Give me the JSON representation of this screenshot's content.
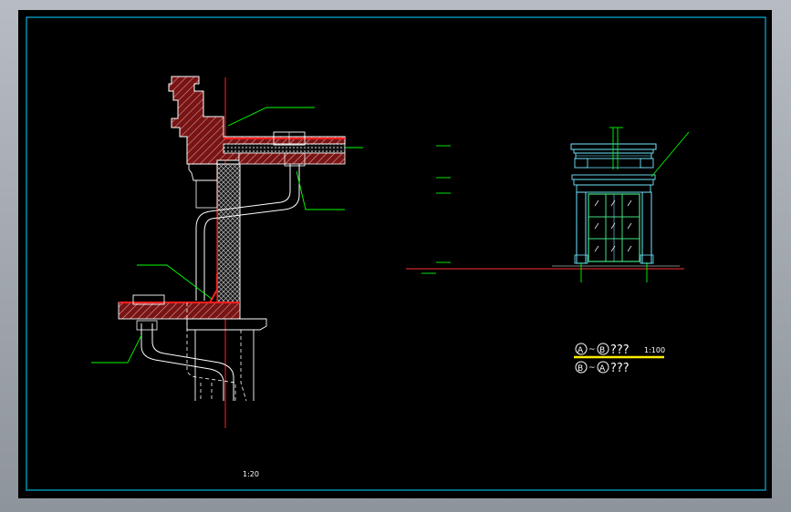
{
  "drawing": {
    "scale_label_detail": "1:20",
    "title_line_1": {
      "marker_a": "A",
      "tilde": "~",
      "marker_b": "B",
      "text": "???",
      "scale": "1:100"
    },
    "title_line_2": {
      "marker_b": "B",
      "tilde": "~",
      "marker_a": "A",
      "text": "???"
    }
  },
  "colors": {
    "background": "#000000",
    "border": "#00b4d8",
    "section_fill": "#8b1a1a",
    "hatch": "#ffffff",
    "leader": "#00ff00",
    "ground_line": "#ff3030",
    "elevation": "#6fe6ff",
    "window": "#40e080",
    "underline": "#ffee00"
  },
  "icons": {
    "section_marker": "circle-letter-icon"
  }
}
